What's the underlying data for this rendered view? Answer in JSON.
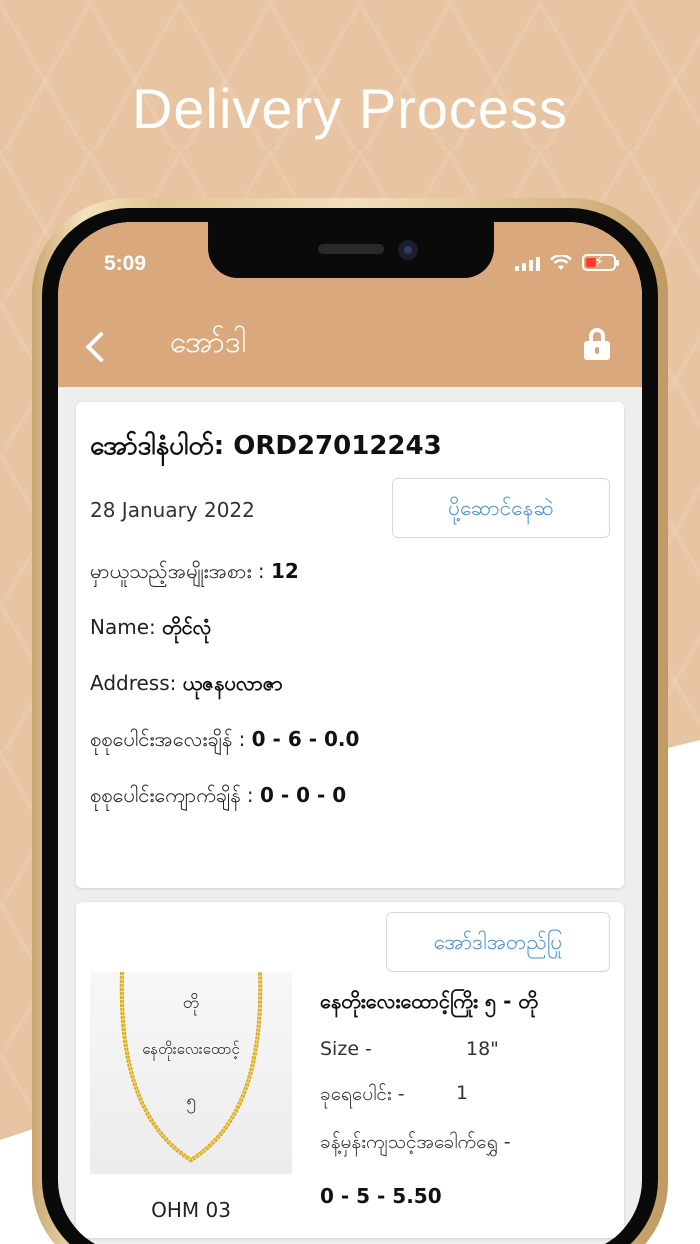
{
  "headline": "Delivery Process",
  "status_bar": {
    "time": "5:09"
  },
  "header": {
    "title": "အော်ဒါ"
  },
  "order": {
    "number_label": "အော်ဒါနံပါတ်: ORD27012243",
    "date": "28 January 2022",
    "status_button": "ပို့ဆောင်နေဆဲ",
    "item_count_label": "မှာယူသည့်အမျိုးအစား :",
    "item_count_value": "12",
    "name_label": "Name:",
    "name_value": "တိုင်လုံ",
    "address_label": "Address:",
    "address_value": "ယုဇနပလာဇာ",
    "total_weight_label": "စုစုပေါင်းအလေးချိန် :",
    "total_weight_value": "0 - 6 - 0.0",
    "total_loss_label": "စုစုပေါင်းကျောက်ချိန် :",
    "total_loss_value": "0 - 0 - 0"
  },
  "product": {
    "detail_button": "အော်ဒါအတည်ပြု",
    "image_text_1": "တို",
    "image_text_2": "နေတိုးလေးထောင့်",
    "image_text_3": "၅",
    "code": "OHM 03",
    "name": "နေတိုးလေးထောင့်ကြိုး ၅ - တို",
    "size_label": "Size -",
    "size_value": "18\"",
    "qty_label": "ခုရေပေါင်း -",
    "qty_value": "1",
    "weight_label": "ခန့်မှန်းကျသင့်အခေါက်ရွှေ -",
    "weight_value": "0 - 5 - 5.50"
  },
  "colors": {
    "background": "#e8c4a2",
    "header": "#d9a87c",
    "accent_text": "#4a90d9"
  },
  "icons": [
    "back-chevron-icon",
    "lock-icon",
    "signal-icon",
    "wifi-icon",
    "battery-icon"
  ]
}
